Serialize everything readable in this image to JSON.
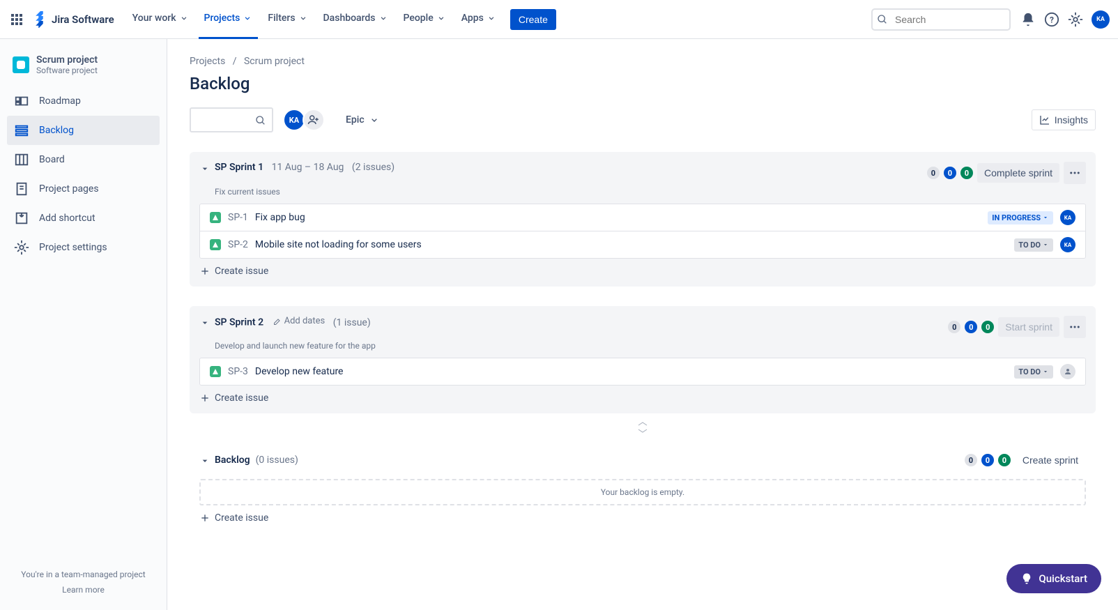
{
  "topbar": {
    "logo": "Jira Software",
    "nav": [
      "Your work",
      "Projects",
      "Filters",
      "Dashboards",
      "People",
      "Apps"
    ],
    "active_nav": 1,
    "create": "Create",
    "search_placeholder": "Search",
    "avatar": "KA"
  },
  "sidebar": {
    "project_name": "Scrum project",
    "project_type": "Software project",
    "items": [
      {
        "label": "Roadmap"
      },
      {
        "label": "Backlog"
      },
      {
        "label": "Board"
      },
      {
        "label": "Project pages"
      },
      {
        "label": "Add shortcut"
      },
      {
        "label": "Project settings"
      }
    ],
    "active_item": 1,
    "footer_line1": "You're in a team-managed project",
    "footer_link": "Learn more"
  },
  "breadcrumbs": [
    "Projects",
    "Scrum project"
  ],
  "page_title": "Backlog",
  "toolbar": {
    "avatar": "KA",
    "epic": "Epic",
    "insights": "Insights"
  },
  "sprints": [
    {
      "name": "SP Sprint 1",
      "dates": "11 Aug – 18 Aug",
      "count": "(2 issues)",
      "goal": "Fix current issues",
      "badges": [
        "0",
        "0",
        "0"
      ],
      "action": "Complete sprint",
      "action_enabled": true,
      "issues": [
        {
          "key": "SP-1",
          "title": "Fix app bug",
          "status": "IN PROGRESS",
          "status_class": "inprogress",
          "assignee": "KA"
        },
        {
          "key": "SP-2",
          "title": "Mobile site not loading for some users",
          "status": "TO DO",
          "status_class": "todo",
          "assignee": "KA"
        }
      ]
    },
    {
      "name": "SP Sprint 2",
      "add_dates": "Add dates",
      "count": "(1 issue)",
      "goal": "Develop and launch new feature for the app",
      "badges": [
        "0",
        "0",
        "0"
      ],
      "action": "Start sprint",
      "action_enabled": false,
      "issues": [
        {
          "key": "SP-3",
          "title": "Develop new feature",
          "status": "TO DO",
          "status_class": "todo",
          "assignee": null
        }
      ]
    }
  ],
  "backlog": {
    "name": "Backlog",
    "count": "(0 issues)",
    "badges": [
      "0",
      "0",
      "0"
    ],
    "action": "Create sprint",
    "empty_text": "Your backlog is empty."
  },
  "create_issue": "Create issue",
  "quickstart": "Quickstart"
}
